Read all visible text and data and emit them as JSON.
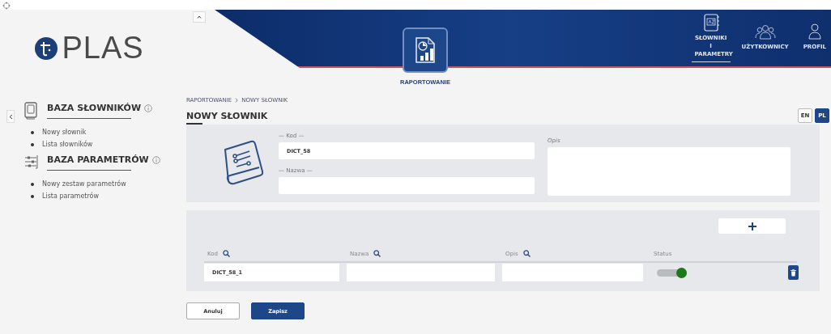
{
  "logo": {
    "text": "PLAS"
  },
  "header": {
    "module": {
      "label": "RAPORTOWANIE"
    },
    "nav": [
      {
        "label": "SŁOWNIKI I PARAMETRY",
        "kind": "dictionary",
        "selected": true
      },
      {
        "label": "UŻYTKOWNICY",
        "kind": "users",
        "selected": false
      },
      {
        "label": "PROFIL",
        "kind": "profile",
        "selected": false
      }
    ]
  },
  "sidebar": {
    "sections": [
      {
        "title": "BAZA SŁOWNIKÓW",
        "kind": "dictionary",
        "items": [
          "Nowy słownik",
          "Lista słowników"
        ]
      },
      {
        "title": "BAZA PARAMETRÓW",
        "kind": "parameters",
        "items": [
          "Nowy zestaw parametrów",
          "Lista parametrów"
        ]
      }
    ]
  },
  "breadcrumb": [
    "RAPORTOWANIE",
    "NOWY SŁOWNIK"
  ],
  "page_title": "NOWY SŁOWNIK",
  "languages": [
    {
      "label": "EN",
      "selected": false
    },
    {
      "label": "PL",
      "selected": true
    }
  ],
  "form": {
    "code": {
      "label": "— Kod —",
      "value": "DICT_58"
    },
    "name": {
      "label": "— Nazwa —"
    },
    "description": {
      "label": "Opis"
    }
  },
  "entries": {
    "columns": [
      {
        "label": "Kod",
        "searchable": true
      },
      {
        "label": "Nazwa",
        "searchable": true
      },
      {
        "label": "Opis",
        "searchable": true
      },
      {
        "label": "Status",
        "searchable": false
      }
    ],
    "rows": [
      {
        "code": "DICT_58_1",
        "active": true
      }
    ]
  },
  "buttons": [
    {
      "label": "Anuluj",
      "kind": "secondary"
    },
    {
      "label": "Zapisz",
      "kind": "primary"
    }
  ]
}
